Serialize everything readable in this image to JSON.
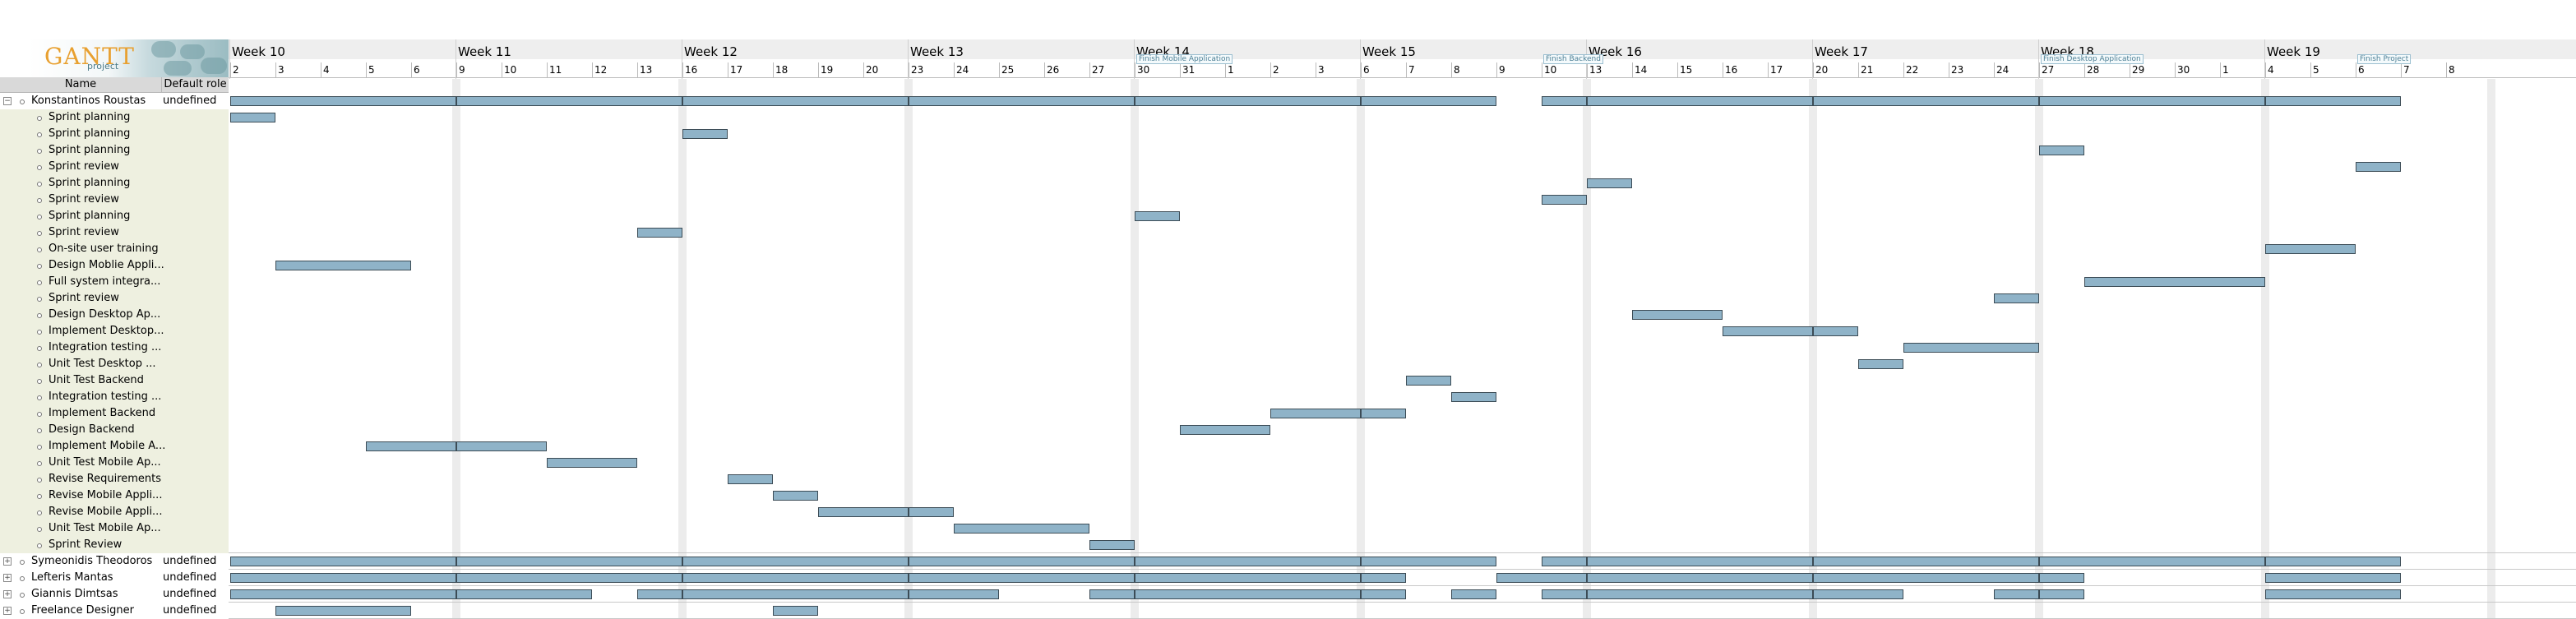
{
  "app": {
    "logo_text": "GANTT",
    "logo_sub": "project"
  },
  "columns": {
    "name": "Name",
    "role": "Default role"
  },
  "rows": [
    {
      "name": "Konstantinos Roustas",
      "role": "undefined",
      "type": "resource",
      "expanded": true
    },
    {
      "name": "Sprint planning",
      "role": "",
      "type": "task"
    },
    {
      "name": "Sprint planning",
      "role": "",
      "type": "task"
    },
    {
      "name": "Sprint planning",
      "role": "",
      "type": "task"
    },
    {
      "name": "Sprint review",
      "role": "",
      "type": "task"
    },
    {
      "name": "Sprint planning",
      "role": "",
      "type": "task"
    },
    {
      "name": "Sprint review",
      "role": "",
      "type": "task"
    },
    {
      "name": "Sprint planning",
      "role": "",
      "type": "task"
    },
    {
      "name": "Sprint review",
      "role": "",
      "type": "task"
    },
    {
      "name": "On-site user training",
      "role": "",
      "type": "task"
    },
    {
      "name": "Design Moblie Appli...",
      "role": "",
      "type": "task"
    },
    {
      "name": "Full system integra...",
      "role": "",
      "type": "task"
    },
    {
      "name": "Sprint review",
      "role": "",
      "type": "task"
    },
    {
      "name": "Design Desktop Ap...",
      "role": "",
      "type": "task"
    },
    {
      "name": "Implement Desktop...",
      "role": "",
      "type": "task"
    },
    {
      "name": "Integration testing ...",
      "role": "",
      "type": "task"
    },
    {
      "name": "Unit Test Desktop ...",
      "role": "",
      "type": "task"
    },
    {
      "name": "Unit Test Backend",
      "role": "",
      "type": "task"
    },
    {
      "name": "Integration testing ...",
      "role": "",
      "type": "task"
    },
    {
      "name": "Implement Backend",
      "role": "",
      "type": "task"
    },
    {
      "name": "Design Backend",
      "role": "",
      "type": "task"
    },
    {
      "name": "Implement Mobile A...",
      "role": "",
      "type": "task"
    },
    {
      "name": "Unit Test Mobile Ap...",
      "role": "",
      "type": "task"
    },
    {
      "name": "Revise Requirements",
      "role": "",
      "type": "task"
    },
    {
      "name": "Revise Mobile Appli...",
      "role": "",
      "type": "task"
    },
    {
      "name": "Revise Mobile Appli...",
      "role": "",
      "type": "task"
    },
    {
      "name": "Unit Test Mobile Ap...",
      "role": "",
      "type": "task"
    },
    {
      "name": "Sprint Review",
      "role": "",
      "type": "task"
    },
    {
      "name": "Symeonidis Theodoros",
      "role": "undefined",
      "type": "resource",
      "expanded": false
    },
    {
      "name": "Lefteris Mantas",
      "role": "undefined",
      "type": "resource",
      "expanded": false
    },
    {
      "name": "Giannis Dimtsas",
      "role": "undefined",
      "type": "resource",
      "expanded": false
    },
    {
      "name": "Freelance Designer",
      "role": "undefined",
      "type": "resource",
      "expanded": false
    }
  ],
  "timeline": {
    "weeks": [
      "Week 10",
      "Week 11",
      "Week 12",
      "Week 13",
      "Week 14",
      "Week 15",
      "Week 16",
      "Week 17",
      "Week 18",
      "Week 19"
    ],
    "days": [
      "2",
      "3",
      "4",
      "5",
      "6",
      "9",
      "10",
      "11",
      "12",
      "13",
      "16",
      "17",
      "18",
      "19",
      "20",
      "23",
      "24",
      "25",
      "26",
      "27",
      "30",
      "31",
      "1",
      "2",
      "3",
      "6",
      "7",
      "8",
      "9",
      "10",
      "13",
      "14",
      "15",
      "16",
      "17",
      "20",
      "21",
      "22",
      "23",
      "24",
      "27",
      "28",
      "29",
      "30",
      "1",
      "4",
      "5",
      "6",
      "7",
      "8"
    ],
    "milestones": [
      "Finish Mobile Application",
      "Finish Backend",
      "Finish Desktop Application",
      "Finish Project"
    ]
  },
  "bars": [
    [
      [
        0,
        4
      ],
      [
        5,
        9
      ],
      [
        10,
        14
      ],
      [
        15,
        19
      ],
      [
        20,
        24
      ],
      [
        25,
        27
      ],
      [
        29,
        29
      ],
      [
        30,
        34
      ],
      [
        35,
        39
      ],
      [
        40,
        44
      ],
      [
        45,
        47
      ]
    ],
    [
      [
        0,
        0
      ]
    ],
    [
      [
        10,
        10
      ]
    ],
    [
      [
        40,
        40
      ]
    ],
    [
      [
        47,
        47
      ]
    ],
    [
      [
        30,
        30
      ]
    ],
    [
      [
        29,
        29
      ]
    ],
    [
      [
        20,
        20
      ]
    ],
    [
      [
        9,
        9
      ]
    ],
    [
      [
        45,
        46
      ]
    ],
    [
      [
        1,
        3
      ]
    ],
    [
      [
        41,
        44
      ]
    ],
    [
      [
        39,
        39
      ]
    ],
    [
      [
        31,
        32
      ]
    ],
    [
      [
        33,
        34
      ],
      [
        35,
        35
      ]
    ],
    [
      [
        37,
        39
      ]
    ],
    [
      [
        36,
        36
      ]
    ],
    [
      [
        26,
        26
      ]
    ],
    [
      [
        27,
        27
      ]
    ],
    [
      [
        23,
        24
      ],
      [
        25,
        25
      ]
    ],
    [
      [
        21,
        22
      ]
    ],
    [
      [
        3,
        4
      ],
      [
        5,
        6
      ]
    ],
    [
      [
        7,
        8
      ]
    ],
    [
      [
        11,
        11
      ]
    ],
    [
      [
        12,
        12
      ]
    ],
    [
      [
        13,
        14
      ],
      [
        15,
        15
      ]
    ],
    [
      [
        16,
        18
      ]
    ],
    [
      [
        19,
        19
      ]
    ],
    [
      [
        0,
        4
      ],
      [
        5,
        9
      ],
      [
        10,
        14
      ],
      [
        15,
        19
      ],
      [
        20,
        24
      ],
      [
        25,
        27
      ],
      [
        29,
        29
      ],
      [
        30,
        34
      ],
      [
        35,
        39
      ],
      [
        40,
        44
      ],
      [
        45,
        47
      ]
    ],
    [
      [
        0,
        4
      ],
      [
        5,
        9
      ],
      [
        10,
        14
      ],
      [
        15,
        19
      ],
      [
        20,
        24
      ],
      [
        25,
        25
      ],
      [
        28,
        29
      ],
      [
        30,
        34
      ],
      [
        35,
        39
      ],
      [
        40,
        40
      ],
      [
        45,
        47
      ]
    ],
    [
      [
        0,
        4
      ],
      [
        5,
        7
      ],
      [
        9,
        9
      ],
      [
        10,
        14
      ],
      [
        15,
        16
      ],
      [
        19,
        19
      ],
      [
        20,
        24
      ],
      [
        25,
        25
      ],
      [
        27,
        27
      ],
      [
        29,
        29
      ],
      [
        30,
        34
      ],
      [
        35,
        36
      ],
      [
        39,
        39
      ],
      [
        40,
        40
      ],
      [
        45,
        47
      ]
    ],
    [
      [
        1,
        3
      ],
      [
        12,
        12
      ]
    ]
  ]
}
